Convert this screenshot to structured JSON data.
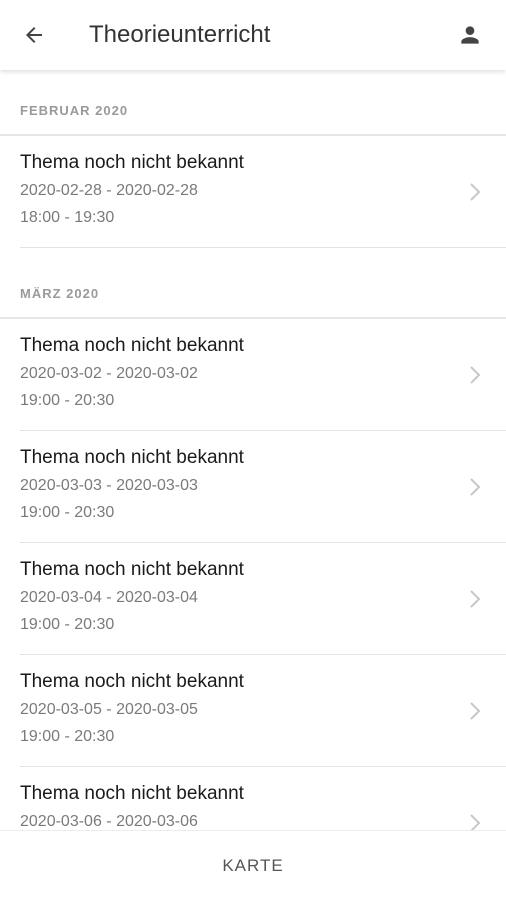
{
  "header": {
    "title": "Theorieunterricht",
    "back_icon": "arrow-left-icon",
    "profile_icon": "person-icon"
  },
  "sections": [
    {
      "label": "FEBRUAR 2020",
      "items": [
        {
          "title": "Thema noch nicht bekannt",
          "date": "2020-02-28 - 2020-02-28",
          "time": "18:00 - 19:30"
        }
      ]
    },
    {
      "label": "MÄRZ 2020",
      "items": [
        {
          "title": "Thema noch nicht bekannt",
          "date": "2020-03-02 - 2020-03-02",
          "time": "19:00 - 20:30"
        },
        {
          "title": "Thema noch nicht bekannt",
          "date": "2020-03-03 - 2020-03-03",
          "time": "19:00 - 20:30"
        },
        {
          "title": "Thema noch nicht bekannt",
          "date": "2020-03-04 - 2020-03-04",
          "time": "19:00 - 20:30"
        },
        {
          "title": "Thema noch nicht bekannt",
          "date": "2020-03-05 - 2020-03-05",
          "time": "19:00 - 20:30"
        },
        {
          "title": "Thema noch nicht bekannt",
          "date": "2020-03-06 - 2020-03-06",
          "time": ""
        }
      ]
    }
  ],
  "bottom_bar": {
    "map_label": "KARTE"
  },
  "colors": {
    "title_text": "#333333",
    "item_title": "#1a1a1a",
    "secondary_text": "#7a7a7a",
    "section_label": "#9a9a9a",
    "divider": "#e3e3e3",
    "chevron": "#c8c8c8"
  }
}
